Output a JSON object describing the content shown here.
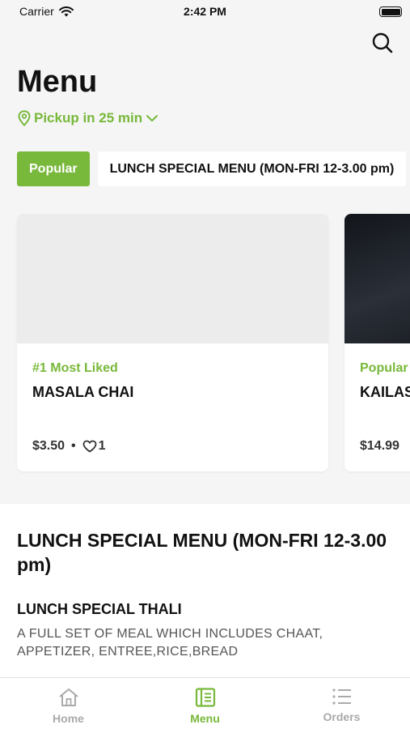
{
  "status": {
    "carrier": "Carrier",
    "time": "2:42 PM"
  },
  "header": {
    "title": "Menu",
    "pickup": "Pickup in 25 min"
  },
  "categories": [
    {
      "label": "Popular",
      "active": true
    },
    {
      "label": "LUNCH SPECIAL MENU (MON-FRI 12-3.00 pm)",
      "active": false
    }
  ],
  "popular_items": [
    {
      "tag": "#1 Most Liked",
      "name": "MASALA CHAI",
      "price": "$3.50",
      "likes": "1"
    },
    {
      "tag": "Popular",
      "name": "KAILAS",
      "price": "$14.99"
    }
  ],
  "section": {
    "title": "LUNCH SPECIAL MENU (MON-FRI 12-3.00 pm)",
    "item_title": "LUNCH SPECIAL THALI",
    "item_desc": "A FULL SET OF MEAL WHICH INCLUDES CHAAT, APPETIZER, ENTREE,RICE,BREAD"
  },
  "tabbar": {
    "home": "Home",
    "menu": "Menu",
    "orders": "Orders"
  },
  "colors": {
    "accent": "#78b83a"
  }
}
